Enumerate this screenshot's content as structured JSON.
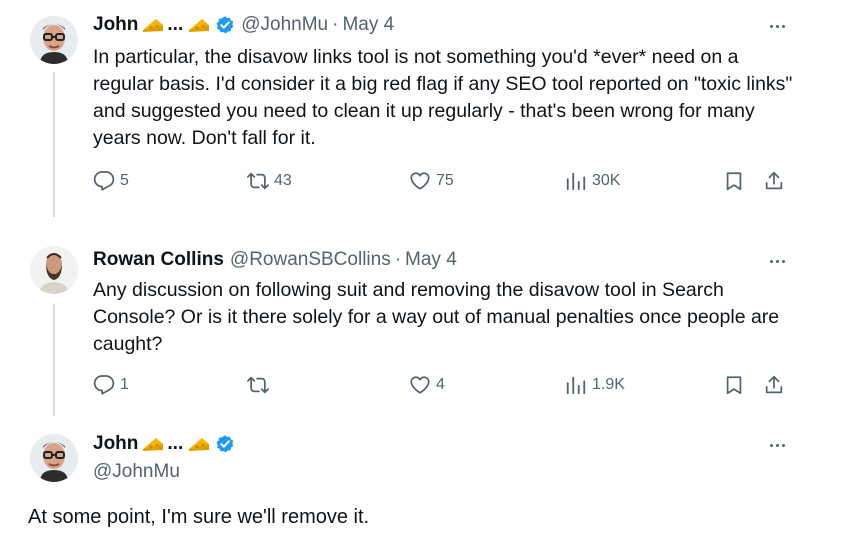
{
  "tweets": [
    {
      "name": "John",
      "name_suffix": "...",
      "handle": "@JohnMu",
      "date": "May 4",
      "text": "In particular, the disavow links tool is not something you'd *ever* need on a regular basis. I'd consider it a big red flag if any SEO tool reported on \"toxic links\" and suggested you need to clean it up regularly - that's been wrong for many years now. Don't fall for it.",
      "replies": "5",
      "reposts": "43",
      "likes": "75",
      "views": "30K"
    },
    {
      "name": "Rowan Collins",
      "handle": "@RowanSBCollins",
      "date": "May 4",
      "text": "Any discussion on following suit and removing the disavow tool in Search Console? Or is it there solely for a way out of manual penalties once people are caught?",
      "replies": "1",
      "reposts": "",
      "likes": "4",
      "views": "1.9K"
    },
    {
      "name": "John",
      "name_suffix": "...",
      "handle": "@JohnMu",
      "text": "At some point, I'm sure we'll remove it."
    }
  ],
  "icons": {
    "reply": "reply-icon",
    "repost": "repost-icon",
    "like": "heart-icon",
    "views": "views-icon",
    "bookmark": "bookmark-icon",
    "share": "share-icon",
    "more": "more-icon",
    "verified": "verified-badge-icon",
    "emoji": "cheese-emoji-icon"
  },
  "colors": {
    "text": "#0f1419",
    "secondary": "#536471",
    "verified": "#1d9bf0",
    "thread_line": "#cfd9de"
  }
}
